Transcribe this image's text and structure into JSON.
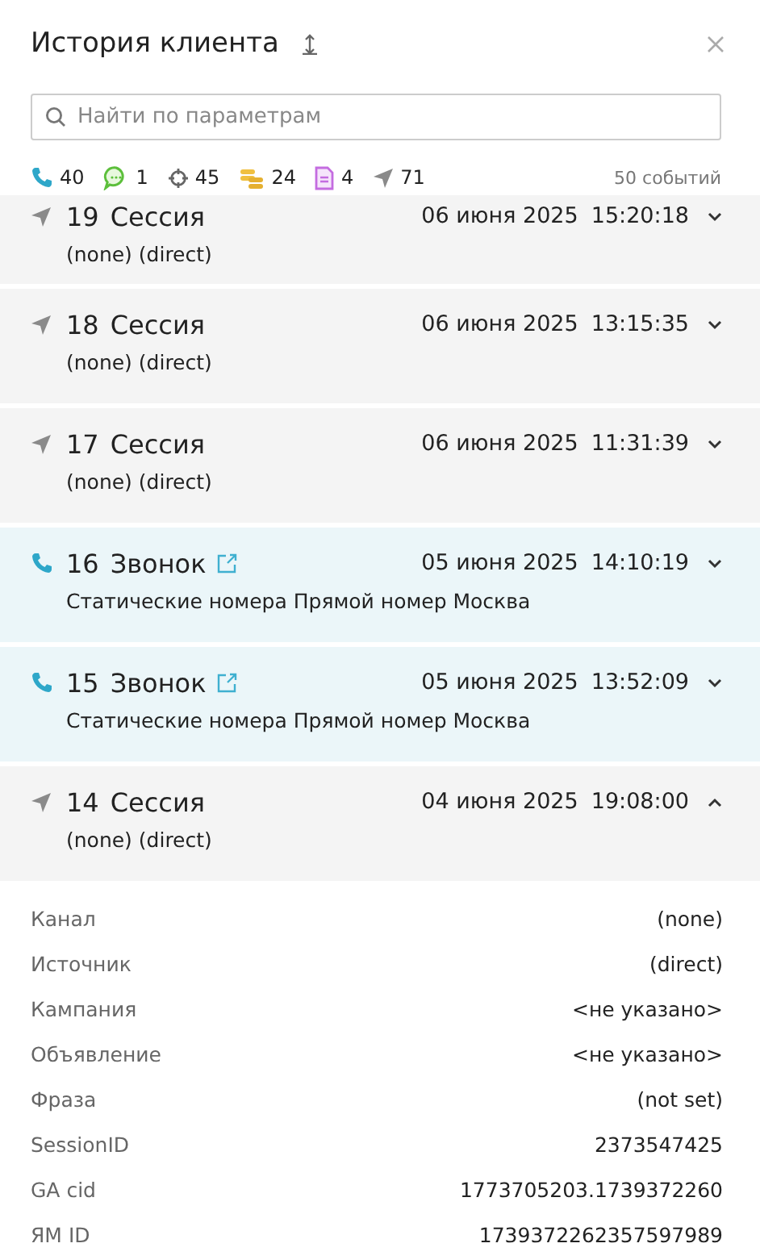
{
  "title": "История клиента",
  "search": {
    "placeholder": "Найти по параметрам"
  },
  "counters": [
    {
      "kind": "call",
      "count": "40"
    },
    {
      "kind": "chat",
      "count": "1"
    },
    {
      "kind": "target",
      "count": "45"
    },
    {
      "kind": "coins",
      "count": "24"
    },
    {
      "kind": "document",
      "count": "4"
    },
    {
      "kind": "session",
      "count": "71"
    }
  ],
  "total": "50 событий",
  "events": [
    {
      "kind": "session",
      "number": "19",
      "title": "Сессия",
      "date": "06 июня 2025",
      "time": "15:20:18",
      "subtitle": "(none) (direct)",
      "expanded": false
    },
    {
      "kind": "session",
      "number": "18",
      "title": "Сессия",
      "date": "06 июня 2025",
      "time": "13:15:35",
      "subtitle": "(none) (direct)",
      "expanded": false
    },
    {
      "kind": "session",
      "number": "17",
      "title": "Сессия",
      "date": "06 июня 2025",
      "time": "11:31:39",
      "subtitle": "(none) (direct)",
      "expanded": false
    },
    {
      "kind": "call",
      "number": "16",
      "title": "Звонок",
      "date": "05 июня 2025",
      "time": "14:10:19",
      "subtitle": "Статические номера Прямой номер Москва",
      "expanded": false
    },
    {
      "kind": "call",
      "number": "15",
      "title": "Звонок",
      "date": "05 июня 2025",
      "time": "13:52:09",
      "subtitle": "Статические номера Прямой номер Москва",
      "expanded": false
    },
    {
      "kind": "session",
      "number": "14",
      "title": "Сессия",
      "date": "04 июня 2025",
      "time": "19:08:00",
      "subtitle": "(none) (direct)",
      "expanded": true,
      "details": [
        {
          "label": "Канал",
          "value": "(none)"
        },
        {
          "label": "Источник",
          "value": "(direct)"
        },
        {
          "label": "Кампания",
          "value": "<не указано>"
        },
        {
          "label": "Объявление",
          "value": "<не указано>"
        },
        {
          "label": "Фраза",
          "value": "(not set)"
        },
        {
          "label": "SessionID",
          "value": "2373547425"
        },
        {
          "label": "GA cid",
          "value": "1773705203.1739372260"
        },
        {
          "label": "ЯМ ID",
          "value": "1739372262357597989"
        }
      ]
    }
  ]
}
